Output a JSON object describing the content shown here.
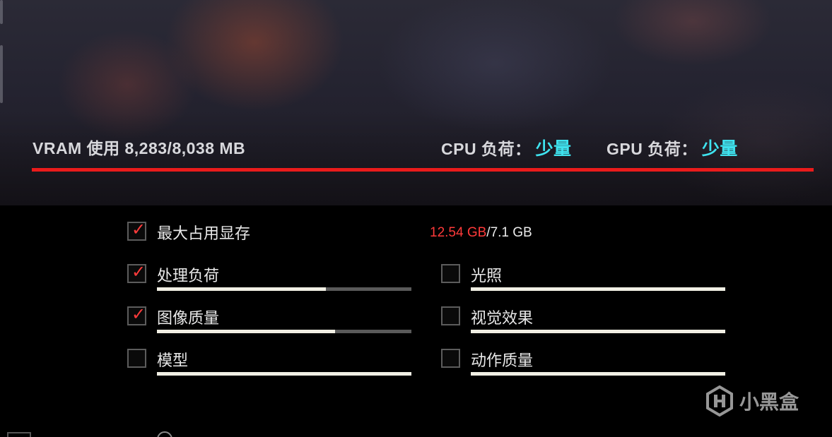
{
  "header": {
    "vram_label": "VRAM 使用 8,283/8,038 MB",
    "cpu_label": "CPU 负荷：",
    "cpu_value": "少量",
    "gpu_label": "GPU 负荷：",
    "gpu_value": "少量",
    "alert_color": "#ea1b1b",
    "value_color": "#3fe3ef"
  },
  "memory": {
    "used": "12.54 GB",
    "separator": "/",
    "total": "7.1 GB"
  },
  "options_left": [
    {
      "label": "最大占用显存",
      "checked": true,
      "bar": null
    },
    {
      "label": "处理负荷",
      "checked": true,
      "bar": 0.665
    },
    {
      "label": "图像质量",
      "checked": true,
      "bar": 0.7
    },
    {
      "label": "模型",
      "checked": false,
      "bar": 1.0
    }
  ],
  "options_right": [
    {
      "label": "光照",
      "checked": false,
      "bar": 1.0
    },
    {
      "label": "视觉效果",
      "checked": false,
      "bar": 1.0
    },
    {
      "label": "动作质量",
      "checked": false,
      "bar": 1.0
    }
  ],
  "checkmark_glyph": "✓",
  "watermark": {
    "text": "小黑盒",
    "icon": "heybox-logo-icon"
  }
}
